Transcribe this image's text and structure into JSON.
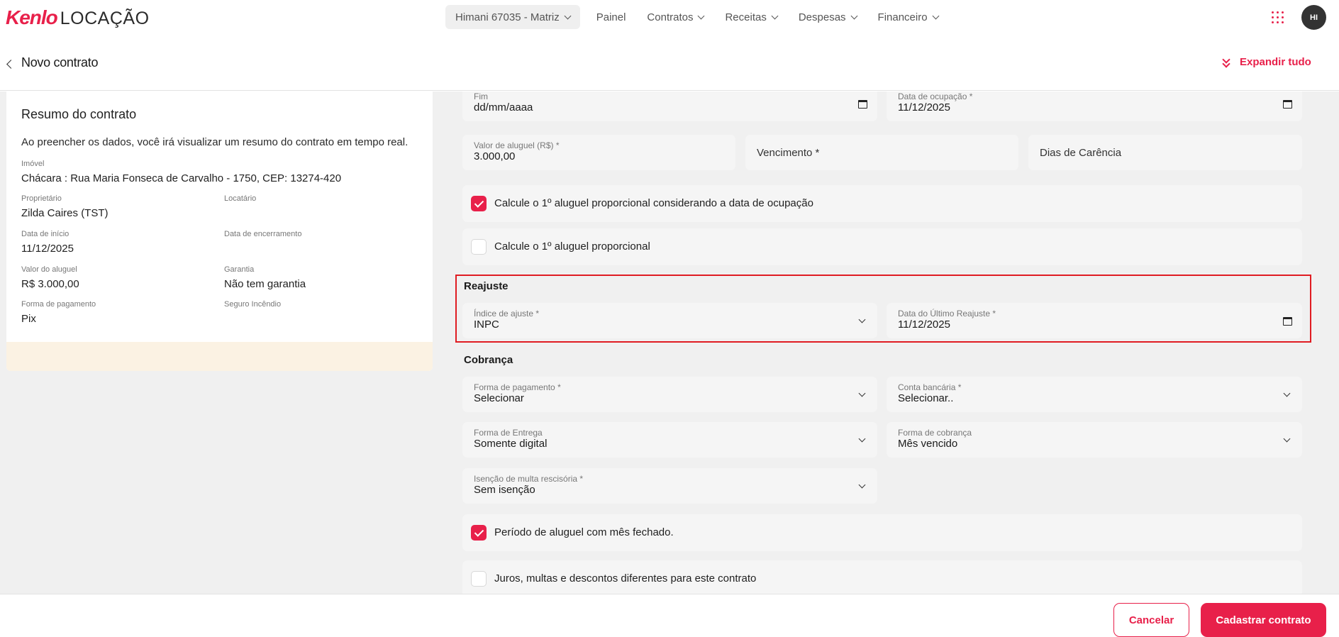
{
  "brand": {
    "logo_primary": "Kenlo",
    "logo_secondary": "LOCAÇÃO",
    "accent_color": "#e8204a"
  },
  "nav": {
    "company": "Himani 67035 - Matriz",
    "items": [
      "Painel",
      "Contratos",
      "Receitas",
      "Despesas",
      "Financeiro"
    ],
    "avatar_initials": "HI",
    "apps_icon": "grid-apps-icon"
  },
  "header": {
    "title": "Novo contrato",
    "expand_label": "Expandir tudo"
  },
  "summary": {
    "title": "Resumo do contrato",
    "description": "Ao preencher os dados, você irá visualizar um resumo do contrato em tempo real.",
    "imovel_label": "Imóvel",
    "imovel_value": "Chácara : Rua Maria Fonseca de Carvalho - 1750, CEP: 13274-420",
    "proprietario_label": "Proprietário",
    "proprietario_value": "Zilda Caires (TST)",
    "locatario_label": "Locatário",
    "locatario_value": "",
    "data_inicio_label": "Data de início",
    "data_inicio_value": "11/12/2025",
    "data_encerramento_label": "Data de encerramento",
    "data_encerramento_value": "",
    "valor_label": "Valor do aluguel",
    "valor_value": "R$ 3.000,00",
    "garantia_label": "Garantia",
    "garantia_value": "Não tem garantia",
    "forma_pagamento_label": "Forma de pagamento",
    "forma_pagamento_value": "Pix",
    "seguro_label": "Seguro Incêndio",
    "seguro_value": ""
  },
  "form": {
    "fim": {
      "label": "Fim",
      "value": "dd/mm/aaaa"
    },
    "data_ocupacao": {
      "label": "Data de ocupação *",
      "value": "11/12/2025"
    },
    "valor_aluguel": {
      "label": "Valor de aluguel (R$) *",
      "value": "3.000,00"
    },
    "vencimento": {
      "placeholder": "Vencimento *"
    },
    "dias_carencia": {
      "placeholder": "Dias de Carência"
    },
    "cb_proporcional_ocupacao": {
      "label": "Calcule o 1º aluguel proporcional considerando a data de ocupação",
      "checked": true
    },
    "cb_proporcional": {
      "label": "Calcule o 1º aluguel proporcional",
      "checked": false
    },
    "reajuste_title": "Reajuste",
    "indice_ajuste": {
      "label": "Índice de ajuste *",
      "value": "INPC"
    },
    "data_ultimo_reajuste": {
      "label": "Data do Último Reajuste *",
      "value": "11/12/2025"
    },
    "cobranca_title": "Cobrança",
    "forma_pagamento": {
      "label": "Forma de pagamento *",
      "value": "Selecionar"
    },
    "conta_bancaria": {
      "label": "Conta bancária *",
      "value": "Selecionar.."
    },
    "forma_entrega": {
      "label": "Forma de Entrega",
      "value": "Somente digital"
    },
    "forma_cobranca": {
      "label": "Forma de cobrança",
      "value": "Mês vencido"
    },
    "isencao_multa": {
      "label": "Isenção de multa rescisória *",
      "value": "Sem isenção"
    },
    "cb_mes_fechado": {
      "label": "Período de aluguel com mês fechado.",
      "checked": true
    },
    "cb_juros": {
      "label": "Juros, multas e descontos diferentes para este contrato",
      "checked": false
    }
  },
  "footer": {
    "cancel_label": "Cancelar",
    "submit_label": "Cadastrar contrato"
  }
}
